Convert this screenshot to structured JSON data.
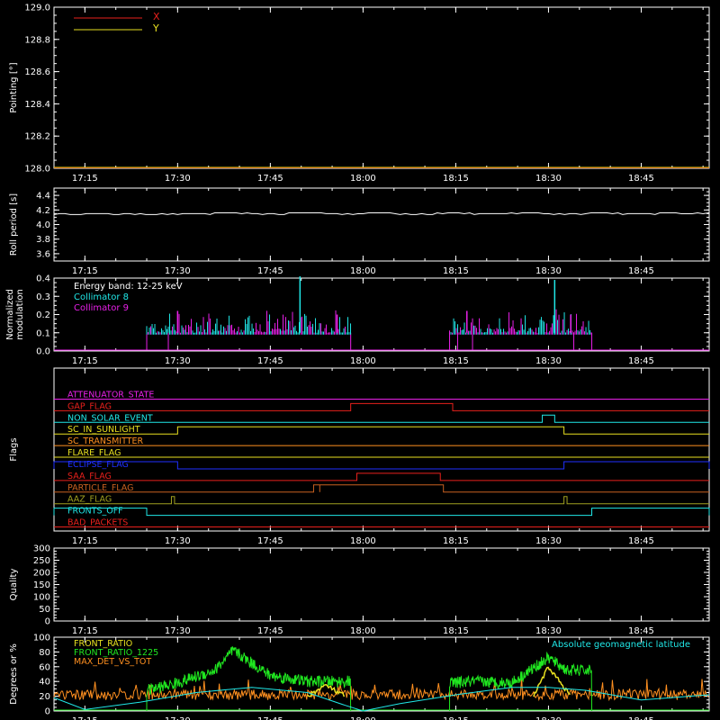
{
  "time_axis": {
    "range_hours": [
      17.1667,
      18.9333
    ],
    "tick_labels": [
      "17:15",
      "17:30",
      "17:45",
      "18:00",
      "18:15",
      "18:30",
      "18:45"
    ],
    "tick_values": [
      17.25,
      17.5,
      17.75,
      18.0,
      18.25,
      18.5,
      18.75
    ]
  },
  "colors": {
    "bg": "#000000",
    "axis": "#ffffff",
    "red": "#e8201c",
    "yellow": "#e8e020",
    "cyan": "#20e8e8",
    "magenta": "#e820e8",
    "green": "#20e820",
    "orange": "#ff9020",
    "blue": "#2030ff",
    "brown": "#c86020",
    "olive": "#a0a020"
  },
  "chart_data": [
    {
      "type": "line",
      "ylabel": "Pointing [°]",
      "ylim": [
        128.0,
        129.0
      ],
      "y_tick_labels": [
        "128.0",
        "128.2",
        "128.4",
        "128.6",
        "128.8",
        "129.0"
      ],
      "y_tick_values": [
        128.0,
        128.2,
        128.4,
        128.6,
        128.8,
        129.0
      ],
      "legend": {
        "position": "top-left",
        "entries": [
          {
            "name": "X",
            "color": "#e8201c"
          },
          {
            "name": "Y",
            "color": "#e8e020"
          }
        ]
      },
      "series": [
        {
          "name": "X",
          "color": "#e8201c",
          "x": [
            17.1667,
            18.9333
          ],
          "values": [
            128.0,
            128.0
          ]
        },
        {
          "name": "Y",
          "color": "#e8e020",
          "x": [
            17.1667,
            18.9333
          ],
          "values": [
            128.0,
            128.0
          ]
        }
      ]
    },
    {
      "type": "line",
      "ylabel": "Roll period [s]",
      "ylim": [
        3.5,
        4.5
      ],
      "y_tick_labels": [
        "3.6",
        "3.8",
        "4.0",
        "4.2",
        "4.4"
      ],
      "y_tick_values": [
        3.6,
        3.8,
        4.0,
        4.2,
        4.4
      ],
      "series": [
        {
          "color": "#ffffff",
          "x": [
            17.1667,
            17.5,
            17.6,
            17.7,
            17.8,
            17.9,
            18.0,
            18.1,
            18.2,
            18.3,
            18.4,
            18.5,
            18.6,
            18.7,
            18.8,
            18.9333
          ],
          "values": [
            4.15,
            4.15,
            4.16,
            4.15,
            4.16,
            4.15,
            4.16,
            4.15,
            4.16,
            4.15,
            4.16,
            4.15,
            4.16,
            4.15,
            4.16,
            4.16
          ]
        }
      ]
    },
    {
      "type": "line",
      "ylabel": "Normalized\nmodulation",
      "ylim": [
        0.0,
        0.4
      ],
      "y_tick_labels": [
        "0.0",
        "0.1",
        "0.2",
        "0.3",
        "0.4"
      ],
      "y_tick_values": [
        0.0,
        0.1,
        0.2,
        0.3,
        0.4
      ],
      "annotation": "Energy band: 12-25 keV",
      "legend": {
        "position": "top-left",
        "entries": [
          {
            "name": "Collimator 8",
            "color": "#20e8e8"
          },
          {
            "name": "Collimator 9",
            "color": "#e820e8"
          }
        ]
      },
      "active_intervals": [
        [
          17.4167,
          17.9667
        ],
        [
          18.2333,
          18.6167
        ]
      ],
      "base_level": 0.1,
      "spikes": [
        {
          "x": 17.83,
          "y": 0.41,
          "color": "#20e8e8"
        },
        {
          "x": 18.5167,
          "y": 0.39,
          "color": "#20e8e8"
        },
        {
          "x": 17.5,
          "y": 0.22,
          "color": "#e820e8"
        },
        {
          "x": 17.93,
          "y": 0.2,
          "color": "#e820e8"
        },
        {
          "x": 18.28,
          "y": 0.22,
          "color": "#e820e8"
        },
        {
          "x": 18.56,
          "y": 0.2,
          "color": "#e820e8"
        }
      ]
    },
    {
      "type": "line",
      "ylabel": "Flags",
      "flags": [
        {
          "name": "ATTENUATOR_STATE",
          "color": "#e820e8",
          "transitions": []
        },
        {
          "name": "GAP_FLAG",
          "color": "#e8201c",
          "transitions": [
            [
              17.9667,
              18.2417
            ]
          ]
        },
        {
          "name": "NON_SOLAR_EVENT",
          "color": "#20e8e8",
          "transitions": [
            [
              18.4833,
              18.5167
            ]
          ]
        },
        {
          "name": "SC_IN_SUNLIGHT",
          "color": "#e8e020",
          "transitions": [
            [
              17.5,
              18.5417
            ]
          ]
        },
        {
          "name": "SC_TRANSMITTER",
          "color": "#ff9020",
          "transitions": []
        },
        {
          "name": "FLARE_FLAG",
          "color": "#e8e020",
          "transitions": []
        },
        {
          "name": "ECLIPSE_FLAG",
          "color": "#2030ff",
          "transitions": [
            [
              17.1667,
              17.5
            ],
            [
              18.5417,
              18.9333
            ]
          ]
        },
        {
          "name": "SAA_FLAG",
          "color": "#e8201c",
          "transitions": [
            [
              17.9833,
              18.2083
            ]
          ]
        },
        {
          "name": "PARTICLE_FLAG",
          "color": "#c86020",
          "transitions": [
            [
              17.8667,
              17.8833
            ],
            [
              17.8833,
              18.2167
            ]
          ]
        },
        {
          "name": "AAZ_FLAG",
          "color": "#a0a020",
          "transitions": [
            [
              17.4833,
              17.4917
            ],
            [
              18.5417,
              18.55
            ]
          ]
        },
        {
          "name": "FRONTS_OFF",
          "color": "#20e8e8",
          "transitions": [
            [
              17.1667,
              17.4167
            ],
            [
              18.6167,
              18.9333
            ]
          ]
        },
        {
          "name": "BAD_PACKETS",
          "color": "#e8201c",
          "transitions": []
        }
      ]
    },
    {
      "type": "line",
      "ylabel": "Quality",
      "ylim": [
        0,
        300
      ],
      "y_tick_labels": [
        "0",
        "50",
        "100",
        "150",
        "200",
        "250",
        "300"
      ],
      "y_tick_values": [
        0,
        50,
        100,
        150,
        200,
        250,
        300
      ],
      "series": []
    },
    {
      "type": "line",
      "ylabel": "Degrees or %",
      "ylim": [
        0,
        100
      ],
      "y_tick_labels": [
        "0",
        "20",
        "40",
        "60",
        "80",
        "100"
      ],
      "y_tick_values": [
        0,
        20,
        40,
        60,
        80,
        100
      ],
      "legend": {
        "position": "top-left",
        "entries": [
          {
            "name": "FRONT_RATIO",
            "color": "#e8e020"
          },
          {
            "name": "FRONT_RATIO_1225",
            "color": "#20e820"
          },
          {
            "name": "MAX_DET_VS_TOT",
            "color": "#ff9020"
          }
        ]
      },
      "right_annotation": {
        "text": "Absolute geomagnetic latitude",
        "color": "#20e8e8"
      },
      "latitude_series": {
        "x": [
          17.1667,
          17.25,
          17.4,
          17.55,
          17.7,
          17.85,
          17.95,
          18.0,
          18.1,
          18.25,
          18.4,
          18.5,
          18.6,
          18.75,
          18.9333
        ],
        "values": [
          18,
          2,
          12,
          25,
          32,
          25,
          8,
          0,
          10,
          22,
          32,
          32,
          28,
          15,
          22
        ]
      },
      "green_intervals": [
        [
          17.4167,
          17.9667
        ],
        [
          18.2333,
          18.6167
        ]
      ],
      "green_levels": [
        {
          "x": [
            17.4167,
            17.5,
            17.6,
            17.65,
            17.75,
            17.85,
            17.9667
          ],
          "values": [
            28,
            38,
            55,
            82,
            48,
            40,
            40
          ]
        },
        {
          "x": [
            18.2333,
            18.3,
            18.4,
            18.5,
            18.55,
            18.6167
          ],
          "values": [
            38,
            40,
            38,
            72,
            55,
            55
          ]
        }
      ],
      "yellow_bumps": [
        {
          "x": [
            17.85,
            17.9,
            17.95
          ],
          "values": [
            20,
            35,
            20
          ]
        },
        {
          "x": [
            18.46,
            18.5,
            18.56
          ],
          "values": [
            20,
            60,
            20
          ]
        }
      ],
      "orange_level": 22
    }
  ]
}
